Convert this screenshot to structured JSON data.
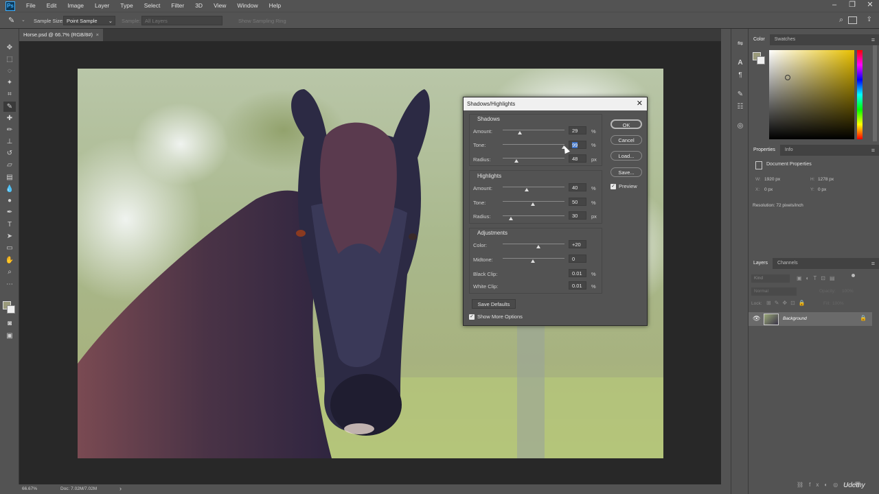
{
  "app": {
    "logo_text": "Ps"
  },
  "menu": [
    "File",
    "Edit",
    "Image",
    "Layer",
    "Type",
    "Select",
    "Filter",
    "3D",
    "View",
    "Window",
    "Help"
  ],
  "options_bar": {
    "sample_size_label": "Sample Size:",
    "sample_size_value": "Point Sample",
    "sample_label": "Sample:",
    "sample_value": "All Layers",
    "sampling_ring": "Show Sampling Ring"
  },
  "document_tab": {
    "title": "Horse.psd @ 66.7% (RGB/8#)",
    "close": "×"
  },
  "status_bar": {
    "zoom": "66.67%",
    "doc": "Doc: 7.02M/7.02M",
    "arrow": "›"
  },
  "color_panel": {
    "tabs": [
      "Color",
      "Swatches"
    ],
    "fg_color": "#9a9a7a",
    "bg_color": "#f0f0f0"
  },
  "properties_panel": {
    "tabs": [
      "Properties",
      "Info"
    ],
    "section_title": "Document Properties",
    "w_label": "W:",
    "w_value": "1920 px",
    "h_label": "H:",
    "h_value": "1278 px",
    "x_label": "X:",
    "x_value": "0 px",
    "y_label": "Y:",
    "y_value": "0 px",
    "resolution": "Resolution: 72 pixels/inch"
  },
  "layers_panel": {
    "tabs": [
      "Layers",
      "Channels"
    ],
    "kind_placeholder": "Kind",
    "blend_mode": "Normal",
    "opacity_label": "Opacity:",
    "opacity_value": "100%",
    "lock_label": "Lock:",
    "fill_label": "Fill:",
    "fill_value": "100%",
    "layer_name": "Background"
  },
  "watermark": "Udemy",
  "dialog": {
    "title": "Shadows/Highlights",
    "close": "✕",
    "shadows": {
      "title": "Shadows",
      "amount_label": "Amount:",
      "amount_value": "29",
      "amount_unit": "%",
      "tone_label": "Tone:",
      "tone_value": "99",
      "tone_unit": "%",
      "radius_label": "Radius:",
      "radius_value": "48",
      "radius_unit": "px"
    },
    "highlights": {
      "title": "Highlights",
      "amount_label": "Amount:",
      "amount_value": "40",
      "amount_unit": "%",
      "tone_label": "Tone:",
      "tone_value": "50",
      "tone_unit": "%",
      "radius_label": "Radius:",
      "radius_value": "30",
      "radius_unit": "px"
    },
    "adjustments": {
      "title": "Adjustments",
      "color_label": "Color:",
      "color_value": "+20",
      "midtone_label": "Midtone:",
      "midtone_value": "0",
      "black_clip_label": "Black Clip:",
      "black_clip_value": "0.01",
      "black_clip_unit": "%",
      "white_clip_label": "White Clip:",
      "white_clip_value": "0.01",
      "white_clip_unit": "%"
    },
    "buttons": {
      "ok": "OK",
      "cancel": "Cancel",
      "load": "Load...",
      "save": "Save..."
    },
    "preview_label": "Preview",
    "save_defaults": "Save Defaults",
    "show_more": "Show More Options"
  }
}
